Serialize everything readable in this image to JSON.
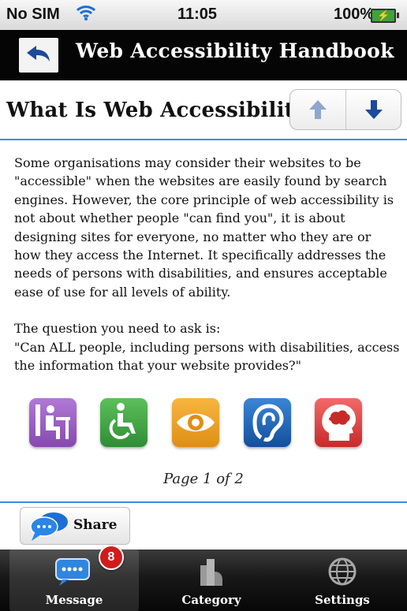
{
  "status_bar": {
    "carrier": "No SIM",
    "time": "11:05",
    "battery_percent": "100%",
    "icons": [
      "wifi-icon",
      "battery-charging-icon"
    ]
  },
  "header": {
    "title": "Web Accessibility Handbook",
    "back_icon": "back-arrow-icon"
  },
  "page": {
    "title": "What Is Web Accessibility",
    "nav": {
      "up_icon": "arrow-up-icon",
      "down_icon": "arrow-down-icon"
    }
  },
  "content": {
    "paragraph_1": "Some organisations may consider their websites to be \"accessible\" when the websites are easily found by search engines. However, the core principle of web accessibility is not about whether people \"can find you\", it is about designing sites for everyone, no matter who they are or how they access the Internet. It specifically addresses the needs of persons with disabilities, and ensures acceptable ease of use for all levels of ability.",
    "paragraph_2": "The question you need to ask is:",
    "paragraph_3": "\"Can ALL people, including persons with disabilities, access the information that your website provides?\""
  },
  "disability_icons": [
    {
      "name": "person-at-desk-icon",
      "color": "#9b5cc0"
    },
    {
      "name": "wheelchair-icon",
      "color": "#4aa84a"
    },
    {
      "name": "eye-icon",
      "color": "#f0a21e"
    },
    {
      "name": "ear-icon",
      "color": "#1f67b5"
    },
    {
      "name": "head-brain-icon",
      "color": "#e03838"
    }
  ],
  "pager": {
    "text": "Page 1 of 2"
  },
  "share": {
    "label": "Share",
    "icon": "speech-bubble-icon"
  },
  "tabbar": {
    "items": [
      {
        "label": "Message",
        "icon": "message-bubble-icon",
        "badge": "8",
        "active": true
      },
      {
        "label": "Category",
        "icon": "buildings-icon",
        "active": false
      },
      {
        "label": "Settings",
        "icon": "globe-icon",
        "active": false
      }
    ]
  },
  "colors": {
    "accent": "#3b8ed8",
    "header_bg": "#050505",
    "nav_arrow": "#1c4a9c"
  }
}
